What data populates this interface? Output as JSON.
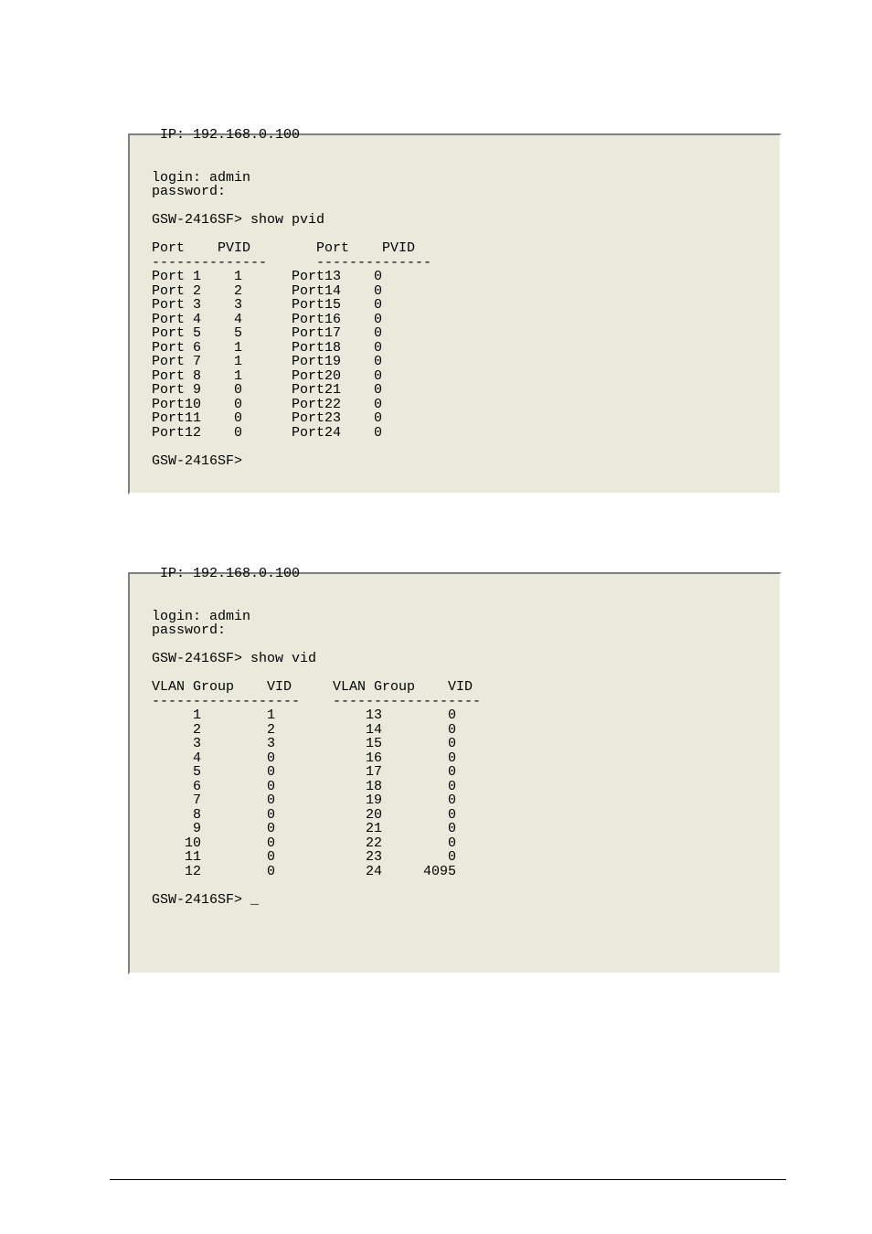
{
  "terminal1": {
    "ip_line": " IP: 192.168.0.100",
    "login_line": "login: admin",
    "password_line": "password:",
    "prompt_cmd": "GSW-2416SF> show pvid",
    "header_left": "Port    PVID",
    "header_right": "Port    PVID",
    "sep": "--------------      --------------",
    "rows": [
      {
        "lport": "Port 1",
        "lpvid": "1",
        "rport": "Port13",
        "rpvid": "0"
      },
      {
        "lport": "Port 2",
        "lpvid": "2",
        "rport": "Port14",
        "rpvid": "0"
      },
      {
        "lport": "Port 3",
        "lpvid": "3",
        "rport": "Port15",
        "rpvid": "0"
      },
      {
        "lport": "Port 4",
        "lpvid": "4",
        "rport": "Port16",
        "rpvid": "0"
      },
      {
        "lport": "Port 5",
        "lpvid": "5",
        "rport": "Port17",
        "rpvid": "0"
      },
      {
        "lport": "Port 6",
        "lpvid": "1",
        "rport": "Port18",
        "rpvid": "0"
      },
      {
        "lport": "Port 7",
        "lpvid": "1",
        "rport": "Port19",
        "rpvid": "0"
      },
      {
        "lport": "Port 8",
        "lpvid": "1",
        "rport": "Port20",
        "rpvid": "0"
      },
      {
        "lport": "Port 9",
        "lpvid": "0",
        "rport": "Port21",
        "rpvid": "0"
      },
      {
        "lport": "Port10",
        "lpvid": "0",
        "rport": "Port22",
        "rpvid": "0"
      },
      {
        "lport": "Port11",
        "lpvid": "0",
        "rport": "Port23",
        "rpvid": "0"
      },
      {
        "lport": "Port12",
        "lpvid": "0",
        "rport": "Port24",
        "rpvid": "0"
      }
    ],
    "prompt_after": "GSW-2416SF>"
  },
  "terminal2": {
    "ip_line": " IP: 192.168.0.100",
    "login_line": "login: admin",
    "password_line": "password:",
    "prompt_cmd": "GSW-2416SF> show vid",
    "header_left": "VLAN Group    VID",
    "header_right": "VLAN Group    VID",
    "sep": "------------------    ------------------",
    "rows": [
      {
        "lgrp": "1",
        "lvid": "1",
        "rgrp": "13",
        "rvid": "0"
      },
      {
        "lgrp": "2",
        "lvid": "2",
        "rgrp": "14",
        "rvid": "0"
      },
      {
        "lgrp": "3",
        "lvid": "3",
        "rgrp": "15",
        "rvid": "0"
      },
      {
        "lgrp": "4",
        "lvid": "0",
        "rgrp": "16",
        "rvid": "0"
      },
      {
        "lgrp": "5",
        "lvid": "0",
        "rgrp": "17",
        "rvid": "0"
      },
      {
        "lgrp": "6",
        "lvid": "0",
        "rgrp": "18",
        "rvid": "0"
      },
      {
        "lgrp": "7",
        "lvid": "0",
        "rgrp": "19",
        "rvid": "0"
      },
      {
        "lgrp": "8",
        "lvid": "0",
        "rgrp": "20",
        "rvid": "0"
      },
      {
        "lgrp": "9",
        "lvid": "0",
        "rgrp": "21",
        "rvid": "0"
      },
      {
        "lgrp": "10",
        "lvid": "0",
        "rgrp": "22",
        "rvid": "0"
      },
      {
        "lgrp": "11",
        "lvid": "0",
        "rgrp": "23",
        "rvid": "0"
      },
      {
        "lgrp": "12",
        "lvid": "0",
        "rgrp": "24",
        "rvid": "4095"
      }
    ],
    "prompt_after": "GSW-2416SF> _"
  }
}
